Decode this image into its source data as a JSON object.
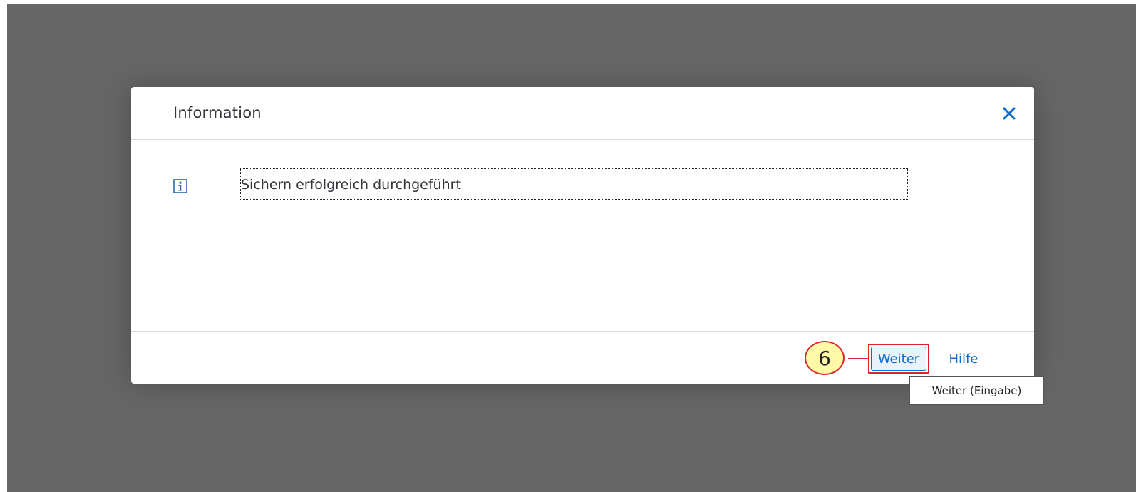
{
  "dialog": {
    "title": "Information",
    "close_icon": "close-icon",
    "message_icon": "info-icon",
    "message": "Sichern erfolgreich durchgeführt"
  },
  "footer": {
    "primary_button_label": "Weiter",
    "help_button_label": "Hilfe",
    "tooltip": "Weiter (Eingabe)",
    "step_number": "6"
  },
  "colors": {
    "overlay": "#666666",
    "accent": "#0a6ed1",
    "highlight": "#d9262c",
    "badge_fill": "#fff9a8"
  }
}
